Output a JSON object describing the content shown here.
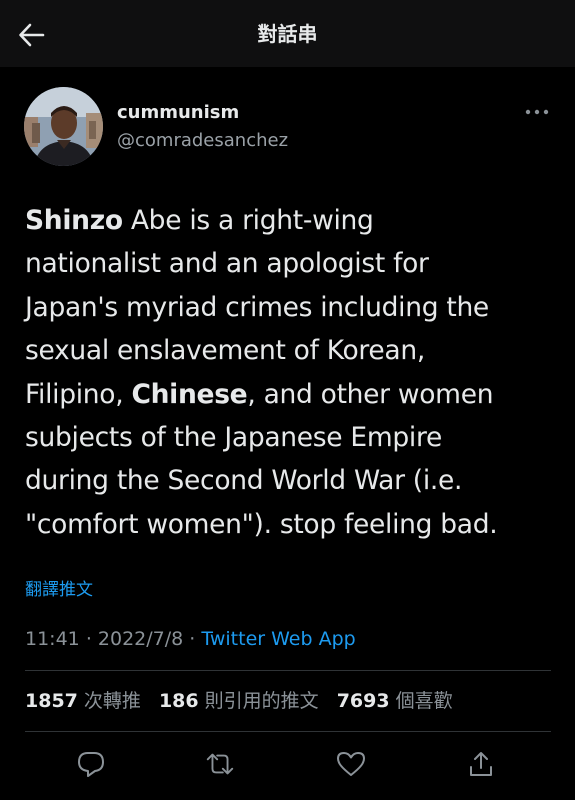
{
  "header": {
    "title": "對話串",
    "back_icon": "arrow-left-icon"
  },
  "author": {
    "display_name": "cummunism",
    "handle": "@comradesanchez",
    "more_icon": "more-horizontal-icon"
  },
  "tweet": {
    "lines": [
      [
        "",
        "Shinzo",
        " Abe is a right-wing"
      ],
      [
        "nationalist and an apologist for"
      ],
      [
        "Japan's myriad crimes including the"
      ],
      [
        "sexual enslavement of Korean,"
      ],
      [
        "Filipino, ",
        "Chinese",
        ", and other women"
      ],
      [
        "subjects of the Japanese Empire"
      ],
      [
        "during the Second World War (i.e."
      ],
      [
        "\"comfort women\"). stop feeling bad."
      ]
    ],
    "translate_label": "翻譯推文",
    "time": "11:41",
    "separator": "·",
    "date": "2022/7/8",
    "source": "Twitter Web App"
  },
  "stats": {
    "retweets": {
      "count": "1857",
      "label": "次轉推"
    },
    "quotes": {
      "count": "186",
      "label": "則引用的推文"
    },
    "likes": {
      "count": "7693",
      "label": "個喜歡"
    }
  },
  "actions": {
    "reply_icon": "reply-icon",
    "retweet_icon": "retweet-icon",
    "like_icon": "heart-icon",
    "share_icon": "share-icon"
  },
  "colors": {
    "background": "#000000",
    "text": "#e7e9ea",
    "secondary": "#8b9298",
    "accent": "#1d9bf0",
    "divider": "#2f3336"
  }
}
